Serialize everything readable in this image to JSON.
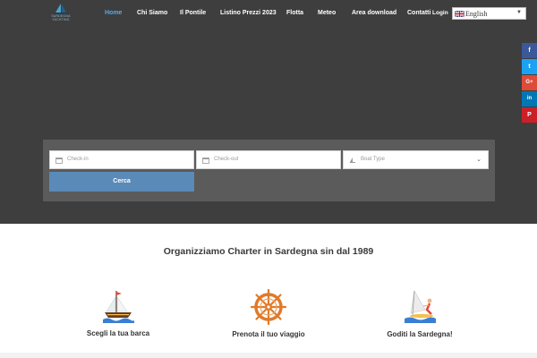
{
  "logo": {
    "text": "SARDEGNA YACHTING"
  },
  "nav": {
    "items": [
      {
        "label": "Home",
        "active": true
      },
      {
        "label": "Chi Siamo"
      },
      {
        "label": "Il Pontile"
      },
      {
        "label": "Listino Prezzi 2023"
      },
      {
        "label": "Flotta"
      },
      {
        "label": "Meteo"
      },
      {
        "label": "Area download"
      },
      {
        "label": "Contatti"
      }
    ],
    "login": "Login"
  },
  "language": {
    "selected": "English"
  },
  "social": {
    "facebook": "f",
    "twitter": "t",
    "google_plus": "G+",
    "linkedin": "in",
    "pinterest": "P"
  },
  "search": {
    "checkin_placeholder": "Check-in",
    "checkout_placeholder": "Check-out",
    "boat_type_placeholder": "Boat Type",
    "submit_label": "Cerca"
  },
  "headline": "Organizziamo Charter in Sardegna sin dal 1989",
  "features": [
    {
      "label": "Scegli la tua barca",
      "icon": "sailboat-icon"
    },
    {
      "label": "Prenota il tuo viaggio",
      "icon": "ship-wheel-icon"
    },
    {
      "label": "Goditi la Sardegna!",
      "icon": "windsurf-icon"
    }
  ],
  "colors": {
    "hero_bg": "#3e3e3e",
    "nav_active": "#5fa7e3",
    "panel_bg": "#5b5b5b",
    "button_bg": "#5a8ab8",
    "facebook": "#3b5998",
    "twitter": "#1da1f2",
    "google_plus": "#dd4b39",
    "linkedin": "#0077b5",
    "pinterest": "#cb2027"
  }
}
